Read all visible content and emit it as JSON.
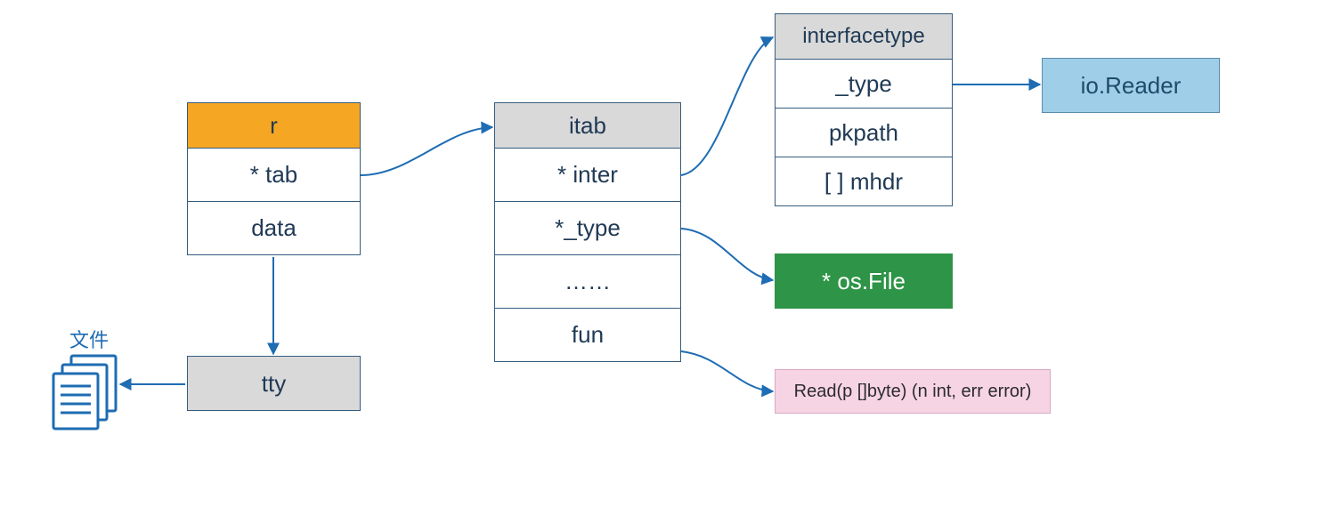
{
  "r_block": {
    "header": "r",
    "fields": [
      "* tab",
      "data"
    ]
  },
  "tty_block": {
    "label": "tty"
  },
  "file_label": "文件",
  "itab_block": {
    "header": "itab",
    "fields": [
      "* inter",
      "*_type",
      "……",
      "fun"
    ]
  },
  "interfacetype_block": {
    "header": "interfacetype",
    "fields": [
      "_type",
      "pkpath",
      "[ ] mhdr"
    ]
  },
  "io_reader": {
    "label": "io.Reader"
  },
  "os_file": {
    "label": "* os.File"
  },
  "read_sig": {
    "label": "Read(p []byte) (n int, err error)"
  },
  "colors": {
    "orange": "#F5A623",
    "gray": "#D9D9D9",
    "blue": "#9FCFE8",
    "green": "#2E9447",
    "pink": "#F6D4E4",
    "arrow": "#1E6CB3"
  }
}
